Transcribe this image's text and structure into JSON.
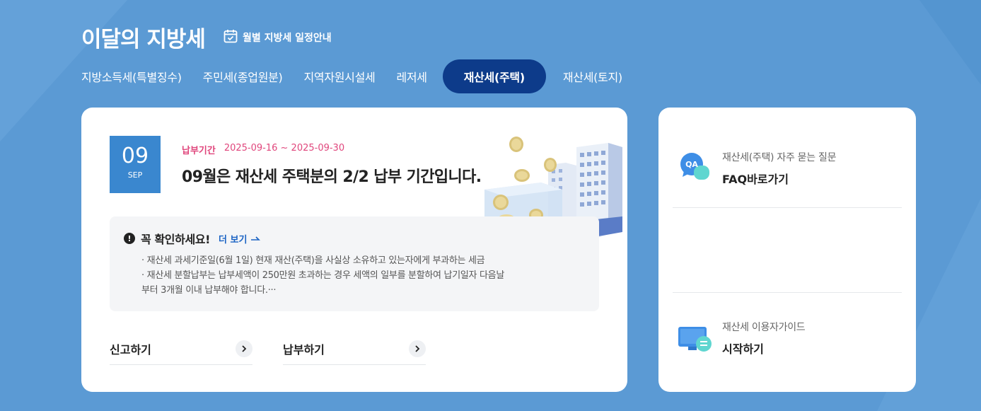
{
  "header": {
    "title": "이달의 지방세",
    "schedule_link": "월별 지방세 일정안내"
  },
  "tabs": [
    {
      "label": "지방소득세(특별징수)",
      "active": false
    },
    {
      "label": "주민세(종업원분)",
      "active": false
    },
    {
      "label": "지역자원시설세",
      "active": false
    },
    {
      "label": "레저세",
      "active": false
    },
    {
      "label": "재산세(주택)",
      "active": true
    },
    {
      "label": "재산세(토지)",
      "active": false
    }
  ],
  "main": {
    "date": {
      "day": "09",
      "month": "SEP"
    },
    "period_label": "납부기간",
    "period_value": "2025-09-16 ~ 2025-09-30",
    "headline": "09월은 재산세 주택분의 2/2 납부 기간입니다.",
    "notice": {
      "title": "꼭 확인하세요!",
      "more": "더 보기",
      "lines": [
        "· 재산세 과세기준일(6월 1일) 현재 재산(주택)을 사실상 소유하고 있는자에게 부과하는 세금",
        "· 재산세 분할납부는 납부세액이 250만원 초과하는 경우 세액의 일부를 분할하여 납기일자 다음날",
        "부터 3개월 이내 납부해야 합니다.···"
      ]
    },
    "actions": [
      {
        "label": "신고하기"
      },
      {
        "label": "납부하기"
      }
    ]
  },
  "side": {
    "faq": {
      "sub": "재산세(주택) 자주 묻는 질문",
      "main": "FAQ바로가기",
      "icon": "qa-chat-icon",
      "icon_text": "QA"
    },
    "guide": {
      "sub": "재산세 이용자가이드",
      "main": "시작하기",
      "icon": "monitor-guide-icon"
    }
  },
  "colors": {
    "background": "#5b9ad4",
    "active_tab": "#0d3b8a",
    "date_box": "#3a87cf",
    "period": "#e0467c",
    "more_link": "#1a63c4"
  }
}
